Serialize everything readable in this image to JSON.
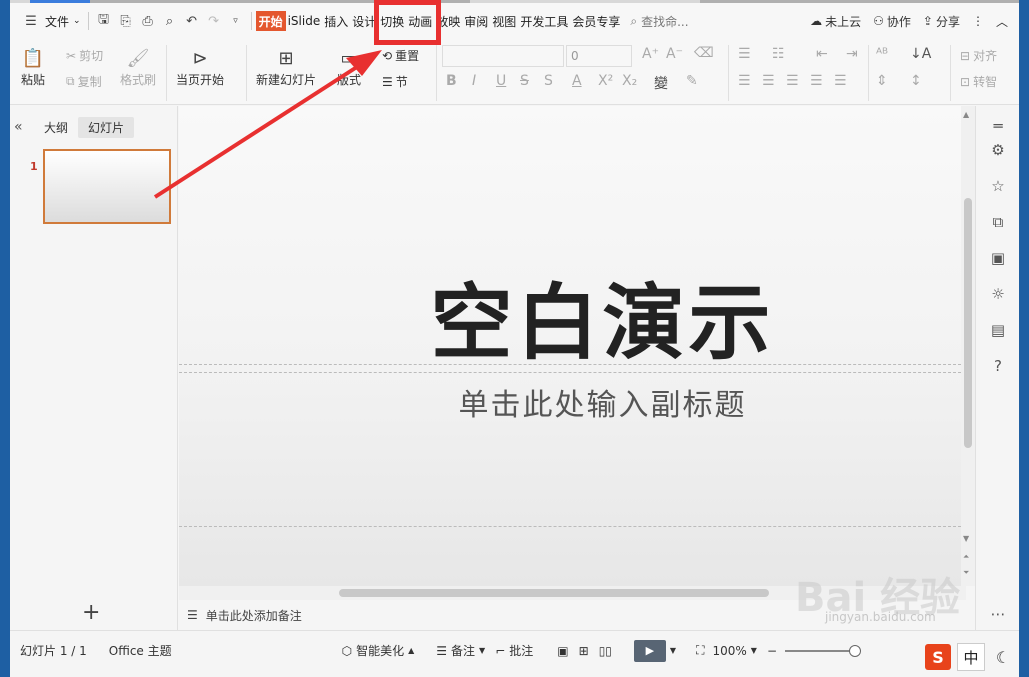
{
  "colors": {
    "accent": "#e4572e",
    "highlight": "#e83030",
    "thumb_border": "#d07a3a"
  },
  "menubar": {
    "file_label": "文件",
    "tabs": [
      "开始",
      "iSlide",
      "插入",
      "设计",
      "切换",
      "动画",
      "放映",
      "审阅",
      "视图",
      "开发工具",
      "会员专享"
    ],
    "search_placeholder": "查找命...",
    "cloud_label": "未上云",
    "collab_label": "协作",
    "share_label": "分享"
  },
  "ribbon": {
    "paste": "粘贴",
    "cut": "剪切",
    "copy": "复制",
    "format_painter": "格式刷",
    "from_current": "当页开始",
    "new_slide": "新建幻灯片",
    "layout": "版式",
    "reset": "重置",
    "section": "节",
    "font_size_value": "0",
    "align_label": "对齐",
    "convert_label": "转智"
  },
  "leftpanel": {
    "outline_tab": "大纲",
    "slides_tab": "幻灯片",
    "thumb_number": "1"
  },
  "slide": {
    "title": "空白演示",
    "subtitle": "单击此处输入副标题"
  },
  "notes": {
    "placeholder": "单击此处添加备注"
  },
  "status": {
    "slide_counter": "幻灯片 1 / 1",
    "theme": "Office 主题",
    "beautify": "智能美化",
    "notes_btn": "备注",
    "comment_btn": "批注",
    "zoom": "100%"
  },
  "watermark": {
    "brand": "Bai 经验",
    "url": "jingyan.baidu.com"
  },
  "ime": {
    "logo": "S",
    "mode": "中"
  }
}
